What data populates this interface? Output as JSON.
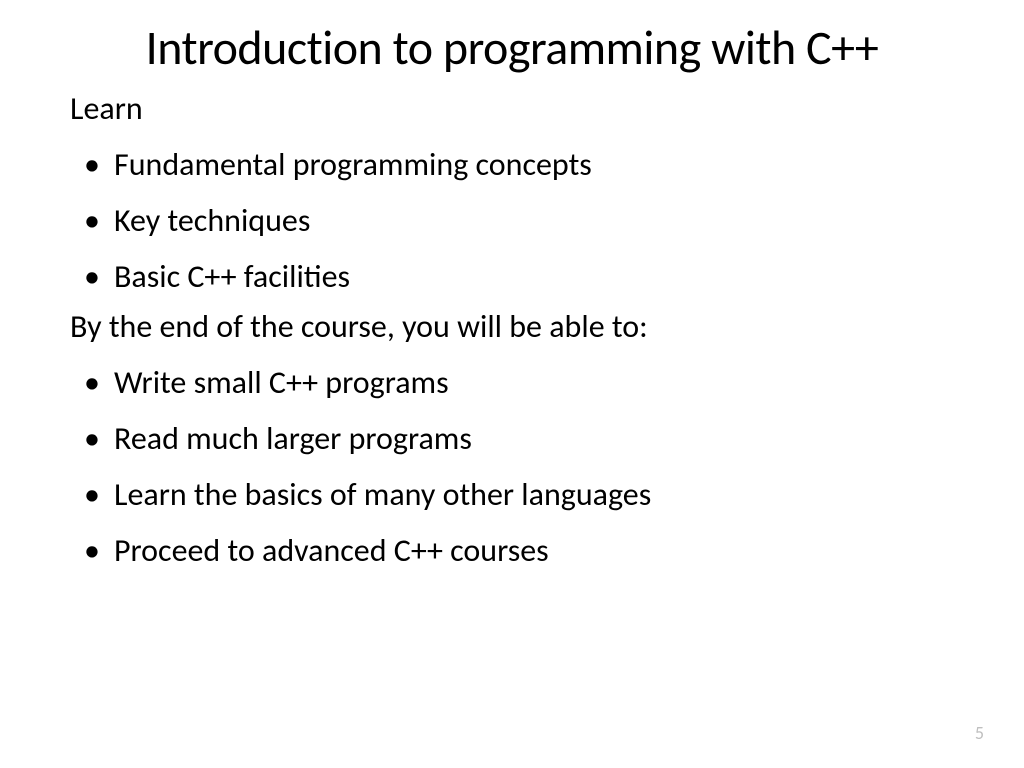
{
  "slide": {
    "title": "Introduction to programming with C++",
    "section1": {
      "label": "Learn",
      "items": [
        "Fundamental programming concepts",
        "Key techniques",
        "Basic C++ facilities"
      ]
    },
    "section2": {
      "label": "By the end of the course, you will be able to:",
      "items": [
        "Write small C++ programs",
        "Read much larger programs",
        "Learn the basics of many other languages",
        "Proceed to advanced C++ courses"
      ]
    },
    "pageNumber": "5"
  }
}
